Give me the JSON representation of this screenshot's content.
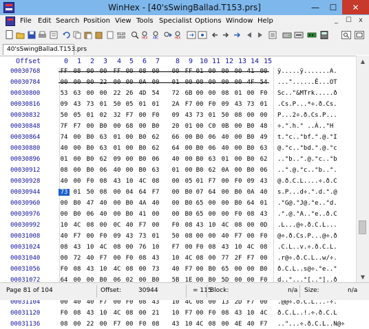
{
  "window": {
    "title": "WinHex - [40'sSwingBallad.T153.prs]",
    "app_icon_text": "HEX",
    "controls": {
      "minimize": "—",
      "maximize": "☐",
      "close": "✕"
    }
  },
  "menu": {
    "items": [
      "File",
      "Edit",
      "Search",
      "Position",
      "View",
      "Tools",
      "Specialist",
      "Options",
      "Window",
      "Help"
    ],
    "mdi_controls": [
      "_",
      "☐",
      "x"
    ]
  },
  "toolbar": {
    "icons": [
      "new-file-icon",
      "open-file-icon",
      "save-icon",
      "print-icon",
      "properties-icon",
      "undo-icon",
      "copy-icon",
      "paste-icon",
      "paste-icon-2",
      "clipboard-icon",
      "binary-icon",
      "find-icon",
      "find-hex-icon",
      "find-text-icon",
      "replace-icon",
      "replace-hex-icon",
      "goto-offset-icon",
      "goto-icon",
      "back-icon",
      "forward-icon",
      "arrow-icon",
      "step-back-icon",
      "step-forward-icon",
      "list-icon",
      "disk-icon",
      "drive-icon",
      "ram-icon",
      "calculator-icon",
      "search-panel-icon"
    ]
  },
  "tab": {
    "label": "40'sSwingBallad.T153.prs"
  },
  "hex": {
    "offset_header": "Offset",
    "columns": [
      "0",
      "1",
      "2",
      "3",
      "4",
      "5",
      "6",
      "7",
      "8",
      "9",
      "10",
      "11",
      "12",
      "13",
      "14",
      "15"
    ],
    "rows": [
      {
        "offset": "00030768",
        "bytes": [
          "FF",
          "08",
          "00",
          "00",
          "FF",
          "00",
          "08",
          "00",
          "00",
          "FF",
          "01",
          "00",
          "00",
          "00",
          "41",
          "00"
        ],
        "text": "ÿ.....ÿ.......A.",
        "strike": true
      },
      {
        "offset": "00030784",
        "bytes": [
          "00",
          "00",
          "00",
          "22",
          "00",
          "00",
          "0A",
          "00",
          "01",
          "00",
          "00",
          "00",
          "00",
          "00",
          "4F",
          "54"
        ],
        "text": "...\"......Ê...OT",
        "strike": true
      },
      {
        "offset": "00030800",
        "bytes": [
          "53",
          "63",
          "00",
          "00",
          "22",
          "26",
          "4D",
          "54",
          "72",
          "6B",
          "00",
          "00",
          "08",
          "01",
          "00",
          "F0"
        ],
        "text": "Sc..\"&MTrk.....ð"
      },
      {
        "offset": "00030816",
        "bytes": [
          "09",
          "43",
          "73",
          "01",
          "50",
          "05",
          "01",
          "01",
          "2A",
          "F7",
          "00",
          "F0",
          "09",
          "43",
          "73",
          "01"
        ],
        "text": ".Cs.P...*÷.ð.Cs."
      },
      {
        "offset": "00030832",
        "bytes": [
          "50",
          "05",
          "01",
          "02",
          "32",
          "F7",
          "00",
          "F0",
          "09",
          "43",
          "73",
          "01",
          "50",
          "08",
          "00",
          "00"
        ],
        "text": "P...2÷.ð.Cs.P..."
      },
      {
        "offset": "00030848",
        "bytes": [
          "7F",
          "F7",
          "00",
          "B0",
          "00",
          "68",
          "00",
          "B0",
          "20",
          "01",
          "00",
          "C0",
          "0B",
          "00",
          "B0",
          "48"
        ],
        "text": "÷.°.h.° ..À..°H"
      },
      {
        "offset": "00030864",
        "bytes": [
          "74",
          "00",
          "B0",
          "63",
          "01",
          "00",
          "B0",
          "62",
          "66",
          "00",
          "B0",
          "06",
          "40",
          "00",
          "B0",
          "49"
        ],
        "text": "t.°c..°bf.°.@.°I"
      },
      {
        "offset": "00030880",
        "bytes": [
          "40",
          "00",
          "B0",
          "63",
          "01",
          "00",
          "B0",
          "62",
          "64",
          "00",
          "B0",
          "06",
          "40",
          "00",
          "B0",
          "63"
        ],
        "text": "@.°c..°bd.°.@.°c"
      },
      {
        "offset": "00030896",
        "bytes": [
          "01",
          "00",
          "B0",
          "62",
          "09",
          "00",
          "B0",
          "06",
          "40",
          "00",
          "B0",
          "63",
          "01",
          "00",
          "B0",
          "62"
        ],
        "text": "..°b..°.@.°c..°b"
      },
      {
        "offset": "00030912",
        "bytes": [
          "08",
          "00",
          "B0",
          "06",
          "40",
          "00",
          "B0",
          "63",
          "01",
          "00",
          "B0",
          "62",
          "0A",
          "00",
          "B0",
          "06"
        ],
        "text": "..°.@.°c..°b..°."
      },
      {
        "offset": "00030928",
        "bytes": [
          "40",
          "00",
          "F0",
          "08",
          "43",
          "10",
          "4C",
          "08",
          "00",
          "05",
          "01",
          "F7",
          "00",
          "F0",
          "09",
          "43"
        ],
        "text": "@.ð.C.L....÷.ð.C"
      },
      {
        "offset": "00030944",
        "bytes": [
          "73",
          "01",
          "50",
          "08",
          "00",
          "04",
          "64",
          "F7",
          "00",
          "B0",
          "07",
          "64",
          "00",
          "B0",
          "0A",
          "40"
        ],
        "text": "s.P...d÷.°.d.°.@",
        "selected": 0
      },
      {
        "offset": "00030960",
        "bytes": [
          "00",
          "B0",
          "47",
          "40",
          "00",
          "B0",
          "4A",
          "40",
          "00",
          "B0",
          "65",
          "00",
          "00",
          "B0",
          "64",
          "01"
        ],
        "text": ".°G@.°J@.°e..°d."
      },
      {
        "offset": "00030976",
        "bytes": [
          "00",
          "B0",
          "06",
          "40",
          "00",
          "B0",
          "41",
          "00",
          "00",
          "B0",
          "65",
          "00",
          "00",
          "F0",
          "08",
          "43"
        ],
        "text": ".°.@.°A..°e..ð.C"
      },
      {
        "offset": "00030992",
        "bytes": [
          "10",
          "4C",
          "08",
          "00",
          "0C",
          "40",
          "F7",
          "00",
          "F0",
          "08",
          "43",
          "10",
          "4C",
          "08",
          "00",
          "0D"
        ],
        "text": ".L...@÷.ð.C.L..."
      },
      {
        "offset": "00031008",
        "bytes": [
          "40",
          "F7",
          "00",
          "F0",
          "09",
          "43",
          "73",
          "01",
          "50",
          "08",
          "00",
          "00",
          "40",
          "F7",
          "00",
          "F0"
        ],
        "text": "@÷.ð.Cs.P...@÷.ð"
      },
      {
        "offset": "00031024",
        "bytes": [
          "08",
          "43",
          "10",
          "4C",
          "08",
          "00",
          "76",
          "10",
          "F7",
          "00",
          "F0",
          "08",
          "43",
          "10",
          "4C",
          "08"
        ],
        "text": ".C.L..v.÷.ð.C.L."
      },
      {
        "offset": "00031040",
        "bytes": [
          "00",
          "72",
          "40",
          "F7",
          "00",
          "F0",
          "08",
          "43",
          "10",
          "4C",
          "08",
          "00",
          "77",
          "2F",
          "F7",
          "00"
        ],
        "text": ".r@÷.ð.C.L..w/÷."
      },
      {
        "offset": "00031056",
        "bytes": [
          "F0",
          "08",
          "43",
          "10",
          "4C",
          "08",
          "00",
          "73",
          "40",
          "F7",
          "00",
          "B0",
          "65",
          "00",
          "00",
          "B0"
        ],
        "text": "ð.C.L..s@÷.°e..°"
      },
      {
        "offset": "00031072",
        "bytes": [
          "64",
          "00",
          "00",
          "B0",
          "06",
          "02",
          "00",
          "B0",
          "5B",
          "1E",
          "00",
          "B0",
          "5D",
          "00",
          "00",
          "F0"
        ],
        "text": "d..°...°[..°]..ð"
      },
      {
        "offset": "00031088",
        "bytes": [
          "08",
          "43",
          "10",
          "4C",
          "08",
          "00",
          "1E",
          "24",
          "F7",
          "00",
          "F0",
          "08",
          "43",
          "10",
          "4C",
          "08"
        ],
        "text": ".C.L...$÷.ð.C.L."
      },
      {
        "offset": "00031104",
        "bytes": [
          "00",
          "40",
          "40",
          "F7",
          "00",
          "F0",
          "08",
          "43",
          "10",
          "4C",
          "08",
          "00",
          "13",
          "2D",
          "F7",
          "00"
        ],
        "text": ".@@÷.ð.C.L...-÷."
      },
      {
        "offset": "00031120",
        "bytes": [
          "F0",
          "08",
          "43",
          "10",
          "4C",
          "08",
          "00",
          "21",
          "10",
          "F7",
          "00",
          "F0",
          "08",
          "43",
          "10",
          "4C"
        ],
        "text": "ð.C.L..!.÷.ð.C.L"
      },
      {
        "offset": "00031136",
        "bytes": [
          "08",
          "00",
          "22",
          "00",
          "F7",
          "00",
          "F0",
          "08",
          "43",
          "10",
          "4C",
          "08",
          "00",
          "4E",
          "40",
          "F7"
        ],
        "text": "..\"...÷.ð.C.L..N@÷"
      }
    ]
  },
  "status": {
    "page": "Page 81 of 104",
    "offset_label": "Offset:",
    "offset_value": "30944",
    "value": "= 115",
    "block_label": "Block:",
    "block_value": "n/a",
    "size_label": "Size:",
    "size_value": "n/a"
  }
}
